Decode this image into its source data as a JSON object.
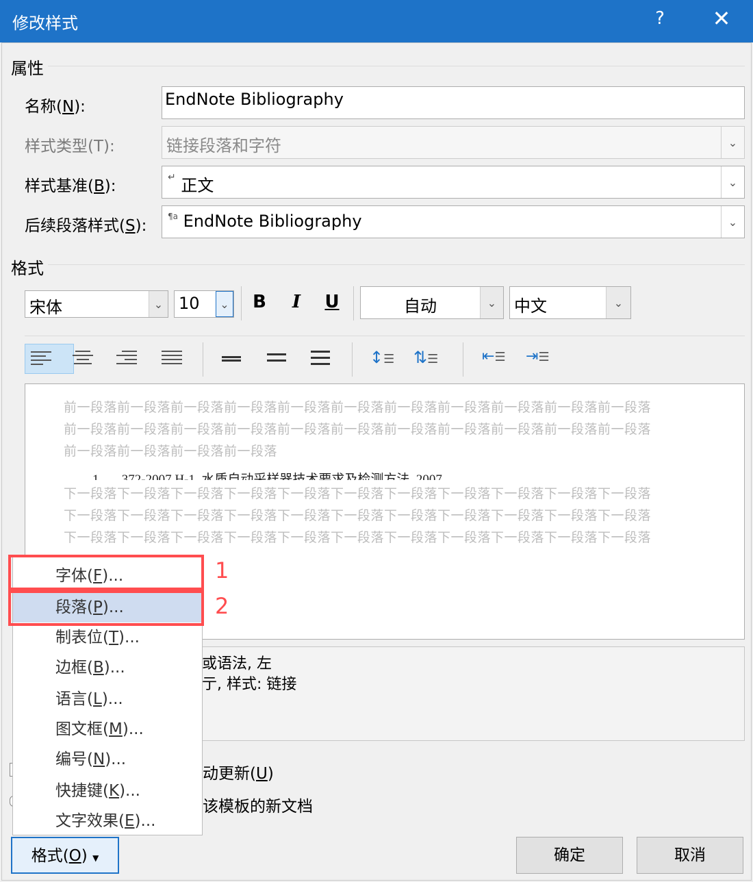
{
  "dialog": {
    "title": "修改样式",
    "help_icon": "?",
    "close_icon": "✕"
  },
  "properties": {
    "section_label": "属性",
    "name_label": "名称(N):",
    "name_value": "EndNote Bibliography",
    "style_type_label": "样式类型(T):",
    "style_type_value": "链接段落和字符",
    "based_on_label": "样式基准(B):",
    "based_on_value": "正文",
    "next_para_label": "后续段落样式(S):",
    "next_para_value": "EndNote Bibliography"
  },
  "format": {
    "section_label": "格式",
    "font_name": "宋体",
    "font_size": "10",
    "bold": "B",
    "italic": "I",
    "underline": "U",
    "color": "自动",
    "script": "中文"
  },
  "preview": {
    "before_lines": [
      "前一段落前一段落前一段落前一段落前一段落前一段落前一段落前一段落前一段落前一段落前一段落",
      "前一段落前一段落前一段落前一段落前一段落前一段落前一段落前一段落前一段落前一段落前一段落",
      "前一段落前一段落前一段落前一段落"
    ],
    "sample_text": "1       372-2007 H-1. 水质自动采样器技术要求及检测方法. 2007.",
    "after_lines": [
      "下一段落下一段落下一段落下一段落下一段落下一段落下一段落下一段落下一段落下一段落下一段落",
      "下一段落下一段落下一段落下一段落下一段落下一段落下一段落下一段落下一段落下一段落下一段落",
      "下一段落下一段落下一段落下一段落下一段落下一段落下一段落下一段落下一段落下一段落下一段落"
    ]
  },
  "description": {
    "line1": "或语法, 左",
    "line2": "亍, 样式: 链接"
  },
  "options": {
    "auto_update": "动更新(U)",
    "new_docs": "该模板的新文档"
  },
  "menu": {
    "items": [
      "字体(F)...",
      "段落(P)...",
      "制表位(T)...",
      "边框(B)...",
      "语言(L)...",
      "图文框(M)...",
      "编号(N)...",
      "快捷键(K)...",
      "文字效果(E)..."
    ],
    "highlighted_index": 1
  },
  "annotations": {
    "marker_1": "1",
    "marker_2": "2",
    "box_color": "#ff4d4f"
  },
  "buttons": {
    "format": "格式(O)",
    "ok": "确定",
    "cancel": "取消"
  },
  "colors": {
    "titlebar": "#1e73c8",
    "accent_highlight": "#cfdcf0"
  }
}
